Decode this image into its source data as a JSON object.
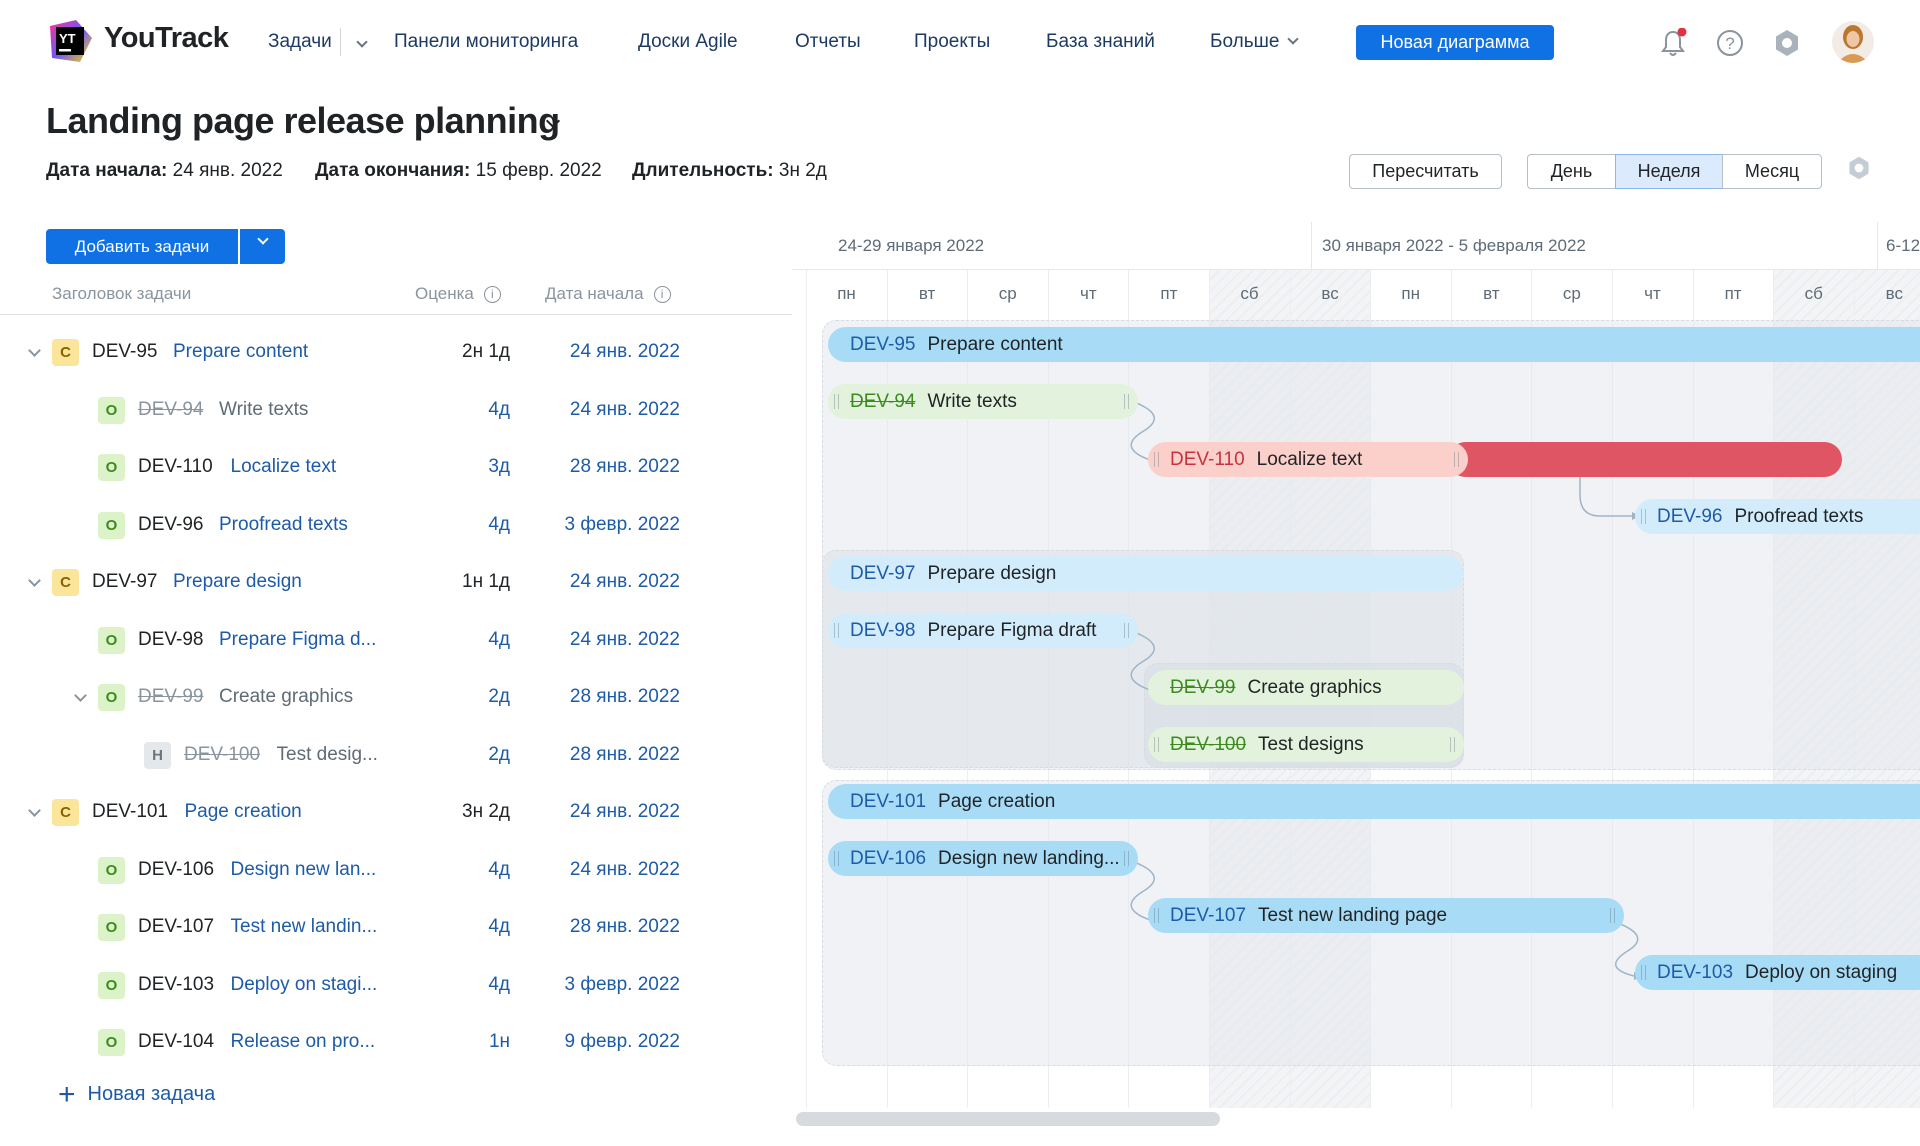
{
  "app": {
    "name": "YouTrack"
  },
  "nav": {
    "items": [
      "Задачи",
      "Панели мониторинга",
      "Доски Agile",
      "Отчеты",
      "Проекты",
      "База знаний",
      "Больше"
    ],
    "new_button": "Новая диаграмма"
  },
  "page": {
    "title": "Landing page release planning",
    "start_label": "Дата начала:",
    "start_value": "24 янв. 2022",
    "end_label": "Дата окончания:",
    "end_value": "15 февр. 2022",
    "duration_label": "Длительность:",
    "duration_value": "3н 2д",
    "recalc_button": "Пересчитать",
    "scale": {
      "options": [
        "День",
        "Неделя",
        "Месяц"
      ],
      "selected": "Неделя"
    }
  },
  "left": {
    "add_button": "Добавить задачи",
    "columns": {
      "title": "Заголовок задачи",
      "estimate": "Оценка",
      "start": "Дата начала"
    },
    "rows": [
      {
        "type": "C",
        "id": "DEV-95",
        "title": "Prepare content",
        "estimate": "2н 1д",
        "date": "24 янв. 2022",
        "done": false
      },
      {
        "type": "O",
        "id": "DEV-94",
        "title": "Write texts",
        "estimate": "4д",
        "date": "24 янв. 2022",
        "done": true
      },
      {
        "type": "O",
        "id": "DEV-110",
        "title": "Localize text",
        "estimate": "3д",
        "date": "28 янв. 2022",
        "done": false
      },
      {
        "type": "O",
        "id": "DEV-96",
        "title": "Proofread texts",
        "estimate": "4д",
        "date": "3 февр. 2022",
        "done": false
      },
      {
        "type": "C",
        "id": "DEV-97",
        "title": "Prepare design",
        "estimate": "1н 1д",
        "date": "24 янв. 2022",
        "done": false
      },
      {
        "type": "O",
        "id": "DEV-98",
        "title": "Prepare Figma d...",
        "estimate": "4д",
        "date": "24 янв. 2022",
        "done": false
      },
      {
        "type": "O",
        "id": "DEV-99",
        "title": "Create graphics",
        "estimate": "2д",
        "date": "28 янв. 2022",
        "done": true
      },
      {
        "type": "H",
        "id": "DEV-100",
        "title": "Test desig...",
        "estimate": "2д",
        "date": "28 янв. 2022",
        "done": true
      },
      {
        "type": "C",
        "id": "DEV-101",
        "title": "Page creation",
        "estimate": "3н 2д",
        "date": "24 янв. 2022",
        "done": false
      },
      {
        "type": "O",
        "id": "DEV-106",
        "title": "Design new lan...",
        "estimate": "4д",
        "date": "24 янв. 2022",
        "done": false
      },
      {
        "type": "O",
        "id": "DEV-107",
        "title": "Test new landin...",
        "estimate": "4д",
        "date": "28 янв. 2022",
        "done": false
      },
      {
        "type": "O",
        "id": "DEV-103",
        "title": "Deploy on stagi...",
        "estimate": "4д",
        "date": "3 февр. 2022",
        "done": false
      },
      {
        "type": "O",
        "id": "DEV-104",
        "title": "Release on pro...",
        "estimate": "1н",
        "date": "9 февр. 2022",
        "done": false
      }
    ],
    "new_task": "Новая задача"
  },
  "gantt": {
    "weeks": [
      "24-29 января 2022",
      "30 января 2022 - 5 февраля 2022",
      "6-12"
    ],
    "days": [
      "пн",
      "вт",
      "ср",
      "чт",
      "пт",
      "сб",
      "вс",
      "пн",
      "вт",
      "ср",
      "чт",
      "пт",
      "сб",
      "вс"
    ],
    "bars": [
      {
        "id": "DEV-95",
        "title": "Prepare content"
      },
      {
        "id": "DEV-94",
        "title": "Write texts"
      },
      {
        "id": "DEV-110",
        "title": "Localize text"
      },
      {
        "id": "DEV-96",
        "title": "Proofread texts"
      },
      {
        "id": "DEV-97",
        "title": "Prepare design"
      },
      {
        "id": "DEV-98",
        "title": "Prepare Figma draft"
      },
      {
        "id": "DEV-99",
        "title": "Create graphics"
      },
      {
        "id": "DEV-100",
        "title": "Test designs"
      },
      {
        "id": "DEV-101",
        "title": "Page creation"
      },
      {
        "id": "DEV-106",
        "title": "Design new landing..."
      },
      {
        "id": "DEV-107",
        "title": "Test new landing page"
      },
      {
        "id": "DEV-103",
        "title": "Deploy on staging"
      }
    ]
  },
  "colors": {
    "accent": "#1071e5",
    "overdue": "#e05563"
  }
}
